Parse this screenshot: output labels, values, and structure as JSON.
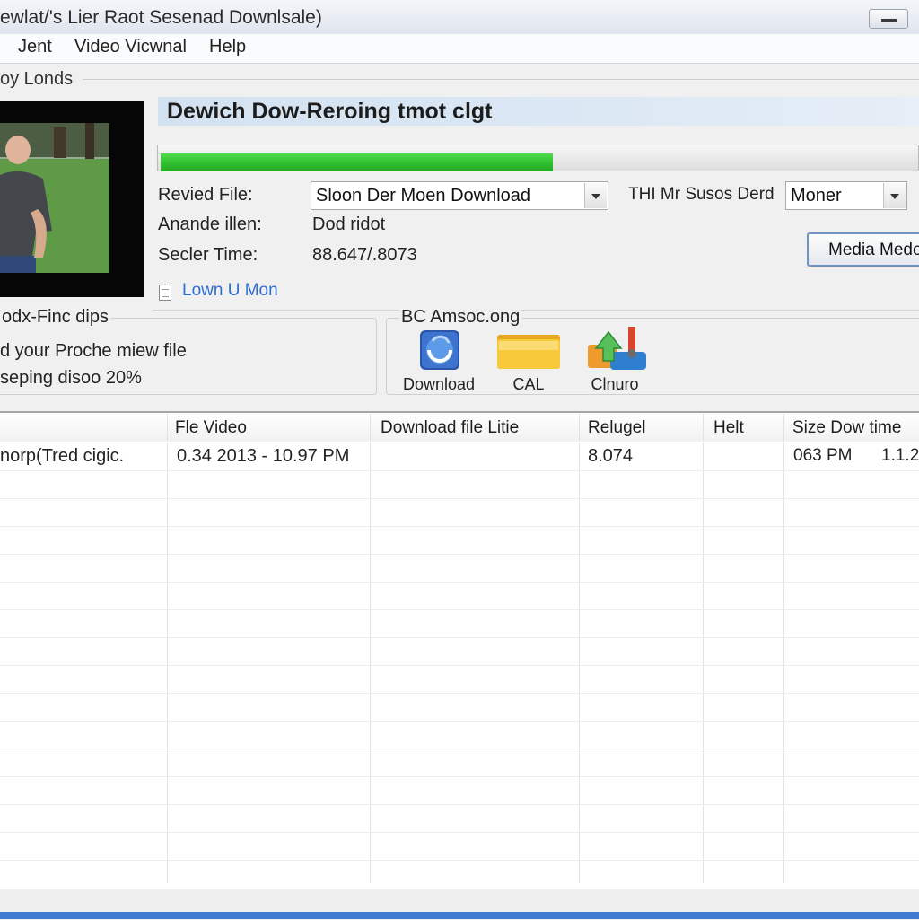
{
  "window": {
    "title": "ewlat/'s Lier Raot Sesenad Downlsale)"
  },
  "menu": [
    {
      "label": "Jent"
    },
    {
      "label": "Video Vicwnal"
    },
    {
      "label": "Help"
    }
  ],
  "section_label": "oy Londs",
  "header": {
    "title": "Dewich Dow-Reroing tmot clgt"
  },
  "progress": {
    "percent": 0.52,
    "fill_color": "#2fbf2f"
  },
  "details": {
    "revised_file_label": "Revied File:",
    "revised_file_value": "Sloon Der Moen Download",
    "anande_label": "Anande illen:",
    "anande_value": "Dod ridot",
    "seeler_time_label": "Secler Time:",
    "seeler_time_value": "88.647/.8073",
    "right_label": "THI Mr Susos Derd",
    "right_combo_value": "Moner",
    "media_button_label": "Media Medo",
    "link_text": "Lown U Mon"
  },
  "left_group": {
    "title": "odx-Finc dips",
    "line1": "d your Proche miew file",
    "line2": "seping disoo 20%"
  },
  "right_group": {
    "title": "BC Amsoc.ong",
    "tools": [
      {
        "label": "Download",
        "icon": "download-globe-icon"
      },
      {
        "label": "CAL",
        "icon": "folder-icon"
      },
      {
        "label": "Clnuro",
        "icon": "upload-arrow-icon"
      }
    ]
  },
  "table": {
    "columns": [
      "",
      "Fle Video",
      "Download file Litie",
      "Relugel",
      "Helt",
      "Size Dow time"
    ],
    "rows": [
      [
        "norp(Tred cigic.",
        "0.34 2013 - 10.97 PM",
        "",
        "8.074",
        "",
        "063 PM",
        "1.1.2"
      ]
    ]
  },
  "colors": {
    "accent": "#3f7ad0",
    "banner": "#d8e5f2",
    "link": "#2f6fcf"
  }
}
